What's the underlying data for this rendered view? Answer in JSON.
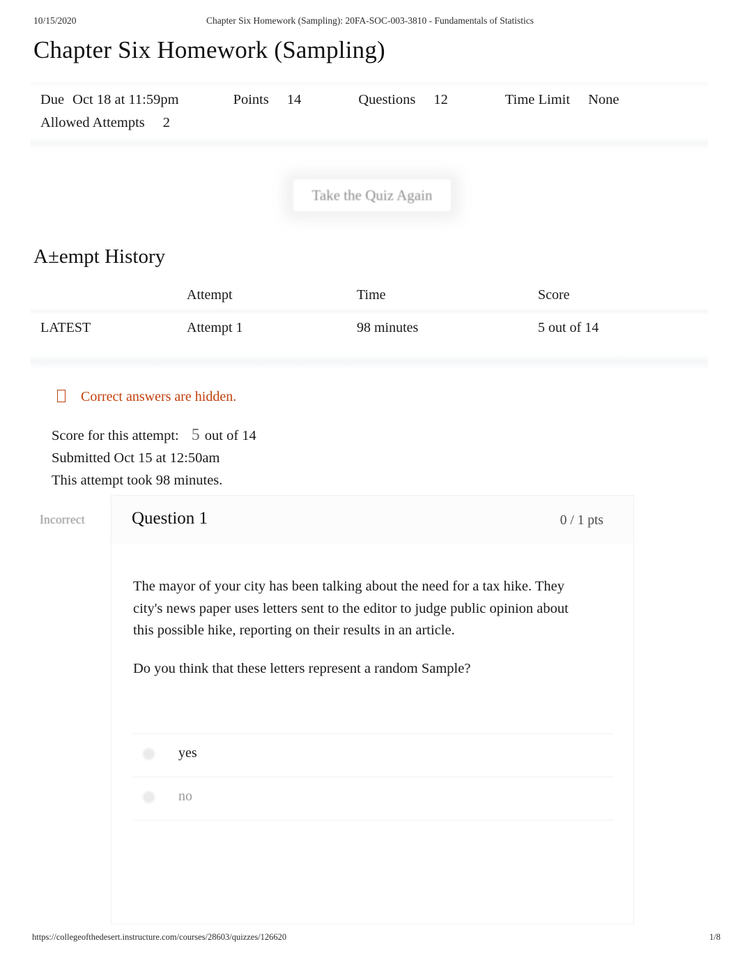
{
  "print": {
    "date": "10/15/2020",
    "header_title": "Chapter Six Homework (Sampling): 20FA-SOC-003-3810 - Fundamentals of Statistics",
    "footer_url": "https://collegeofthedesert.instructure.com/courses/28603/quizzes/126620",
    "page_number": "1/8"
  },
  "quiz": {
    "title": "Chapter Six Homework (Sampling)",
    "meta": {
      "due_label": "Due",
      "due_value": "Oct 18 at 11:59pm",
      "points_label": "Points",
      "points_value": "14",
      "questions_label": "Questions",
      "questions_value": "12",
      "time_limit_label": "Time Limit",
      "time_limit_value": "None",
      "allowed_attempts_label": "Allowed Attempts",
      "allowed_attempts_value": "2"
    },
    "take_again_button": "Take the Quiz Again"
  },
  "attempt_history": {
    "section_title": "A±empt History",
    "headers": {
      "blank": "",
      "attempt": "Attempt",
      "time": "Time",
      "score": "Score"
    },
    "rows": [
      {
        "marker": "LATEST",
        "attempt": "Attempt 1",
        "time": "98 minutes",
        "score": "5 out of 14"
      }
    ]
  },
  "notice": {
    "icon": "info-tofu-icon",
    "text": "Correct answers are hidden.",
    "color": "#c2410c"
  },
  "summary": {
    "score_label": "Score for this attempt:",
    "score_value": "5",
    "score_suffix": "out of 14",
    "submitted": "Submitted Oct 15 at 12:50am",
    "duration": "This attempt took 98 minutes."
  },
  "question": {
    "status": "Incorrect",
    "title": "Question 1",
    "points": "0 / 1 pts",
    "paragraphs": [
      "The mayor of your city has been talking about the need for a tax hike. They city's news paper uses letters sent to the editor to judge public opinion about this possible hike, reporting on their results in an article.",
      "Do you think that these letters represent a random Sample?"
    ],
    "answers": [
      {
        "label": "yes",
        "state": "picked"
      },
      {
        "label": "no",
        "state": "other"
      }
    ]
  }
}
